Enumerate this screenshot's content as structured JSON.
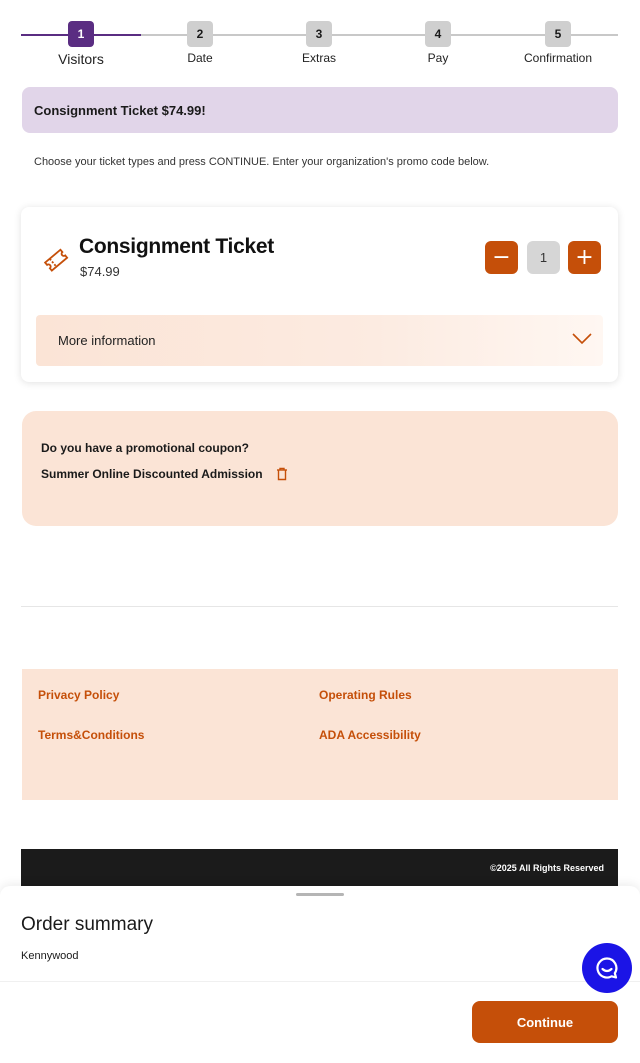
{
  "stepper": {
    "steps": [
      {
        "number": "1",
        "label": "Visitors",
        "active": true
      },
      {
        "number": "2",
        "label": "Date",
        "active": false
      },
      {
        "number": "3",
        "label": "Extras",
        "active": false
      },
      {
        "number": "4",
        "label": "Pay",
        "active": false
      },
      {
        "number": "5",
        "label": "Confirmation",
        "active": false
      }
    ]
  },
  "banner": {
    "text": "Consignment Ticket $74.99!"
  },
  "instructions": "Choose your ticket types and press CONTINUE. Enter your organization's promo code below.",
  "ticket": {
    "name": "Consignment Ticket",
    "price": "$74.99",
    "quantity": "1",
    "minus_symbol": "−",
    "plus_symbol": "+",
    "more_info_label": "More information",
    "icon": "ticket-icon"
  },
  "coupon": {
    "question": "Do you have a promotional coupon?",
    "applied_code": "Summer Online Discounted Admission",
    "icon": "trash-icon"
  },
  "footer": {
    "links": [
      "Privacy Policy",
      "Operating Rules",
      "Terms&Conditions",
      "ADA Accessibility"
    ],
    "copyright": "©2025 All Rights Reserved"
  },
  "order_summary": {
    "title": "Order summary",
    "venue": "Kennywood",
    "continue_label": "Continue",
    "chat_icon": "chat-icon"
  },
  "colors": {
    "primary_purple": "#5a2d82",
    "accent_orange": "#c54f09",
    "peach_background": "#fbe4d6",
    "banner_lavender": "#e1d5e9",
    "chat_blue": "#1b14e6"
  }
}
